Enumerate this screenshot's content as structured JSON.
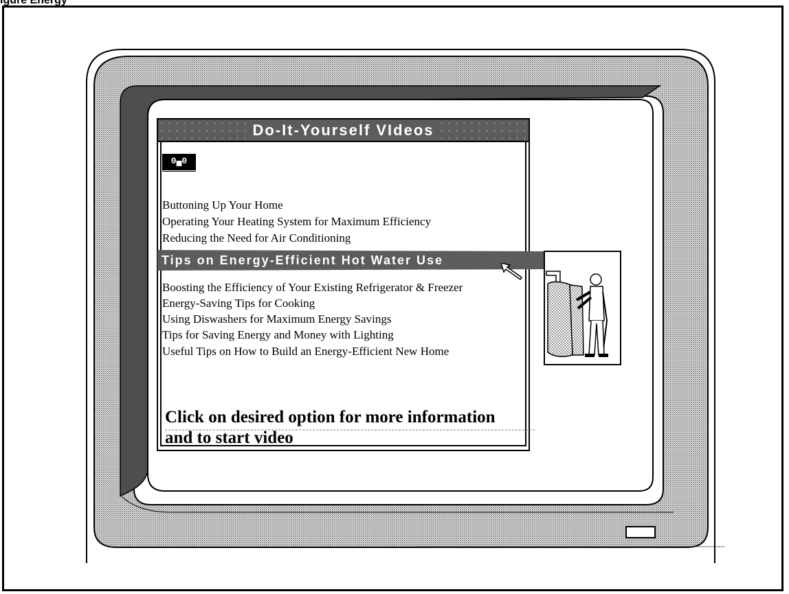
{
  "page": {
    "caption": "igure  Energy"
  },
  "window": {
    "title": "Do-It-Yourself VIdeos",
    "vcr_label": "0▄0"
  },
  "options": [
    "Buttoning Up Your Home",
    "Operating Your Heating System for Maximum Efficiency",
    "Reducing the Need for Air Conditioning",
    "Tips on Energy-Efficient Hot Water Use",
    "Boosting the Efficiency of Your Existing Refrigerator & Freezer",
    "Energy-Saving Tips for Cooking",
    "Using Diswashers for Maximum Energy Savings",
    "Tips for Saving Energy and Money with Lighting",
    "Useful Tips on How to Build an Energy-Efficient New Home"
  ],
  "selected_option_index": 3,
  "instructions": {
    "line1": "Click on desired option for more information",
    "line2": "and to start video"
  },
  "colors": {
    "highlight": "#5c5c5c",
    "bezel": "#9c9c9c",
    "text": "#000000"
  }
}
